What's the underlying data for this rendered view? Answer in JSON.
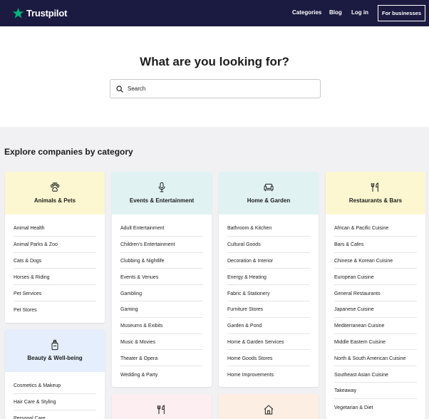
{
  "header": {
    "logo_text": "Trustpilot",
    "nav": [
      "Categories",
      "Blog",
      "Log in"
    ],
    "business_button": "For businesses"
  },
  "hero": {
    "title": "What are you looking for?",
    "search_placeholder": "Search"
  },
  "categories": {
    "heading": "Explore companies by category",
    "cards": [
      {
        "title": "Animals & Pets",
        "icon": "paw-icon",
        "color": "#fcf7d0",
        "items": [
          "Animal Health",
          "Animal Parks & Zoo",
          "Cats & Dogs",
          "Horses & Riding",
          "Pet Services",
          "Pet Stores"
        ]
      },
      {
        "title": "Events & Entertainment",
        "icon": "microphone-icon",
        "color": "#e1f2f3",
        "items": [
          "Adult Entertainment",
          "Children's Entertainment",
          "Clubbing & Nightlife",
          "Events & Venues",
          "Gambling",
          "Gaming",
          "Museums & Exibits",
          "Music & Movies",
          "Theater & Opera",
          "Wedding & Party"
        ]
      },
      {
        "title": "Home & Garden",
        "icon": "sofa-icon",
        "color": "#e1f2f3",
        "items": [
          "Bathroom & Kitchen",
          "Cultural Goods",
          "Decoration & Interior",
          "Energy & Heating",
          "Fabric & Stationery",
          "Furniture Stores",
          "Garden & Pond",
          "Home & Garden Services",
          "Home Goods Stores",
          "Home Improvements"
        ]
      },
      {
        "title": "Restaurants & Bars",
        "icon": "cutlery-icon",
        "color": "#fcf7d0",
        "items": [
          "African & Pacific Cuisine",
          "Bars & Cafes",
          "Chinese & Korean Cuisine",
          "European Cuisine",
          "General Restaurants",
          "Japanese Cuisine",
          "Mediterranean Cuisine",
          "Middle Eastern Cuisine",
          "North & South American Cuisine",
          "Southeast Asian Cuisine",
          "Takeaway",
          "Vegetarian & Diet"
        ]
      },
      {
        "title": "Beauty & Well-being",
        "icon": "lotion-bottle-icon",
        "color": "#e4eefc",
        "items": [
          "Cosmetics & Makeup",
          "Hair Care & Styling",
          "Personal Care"
        ]
      },
      {
        "title": "",
        "icon": "cutlery-icon",
        "color": "#fdeef2",
        "items": []
      },
      {
        "title": "",
        "icon": "house-icon",
        "color": "#fdeee4",
        "items": []
      }
    ]
  }
}
